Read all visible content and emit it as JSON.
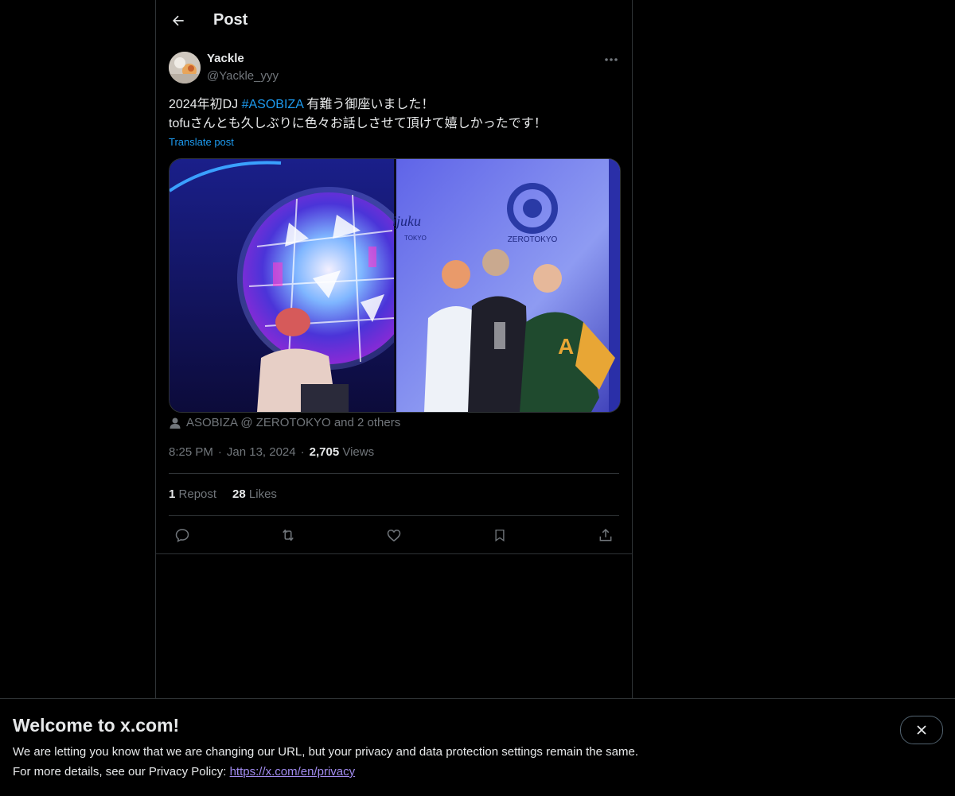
{
  "header": {
    "title": "Post",
    "back_icon": "arrow-left-icon"
  },
  "post": {
    "author": {
      "display_name": "Yackle",
      "handle": "@Yackle_yyy"
    },
    "text_line1_prefix": "2024年初DJ ",
    "hashtag": "#ASOBIZA",
    "text_line1_suffix": " 有難う御座いました！",
    "text_line2": "tofuさんとも久しぶりに色々お話しさせて頂けて嬉しかったです！",
    "translate_label": "Translate post",
    "media": {
      "left_image": "DJ performing in front of a large glowing disco-ball style screen",
      "right_image": "Three people posing in front of a ZEROTOKYO wall",
      "right_logo_text": "ZEROTOKYO",
      "right_sign_text": "ijuku",
      "right_sign_sub": "TOKYO"
    },
    "tagged": "ASOBIZA @ ZEROTOKYO and 2 others",
    "time": "8:25 PM",
    "date": "Jan 13, 2024",
    "views_count": "2,705",
    "views_label": "Views",
    "reposts_count": "1",
    "reposts_label": "Repost",
    "likes_count": "28",
    "likes_label": "Likes"
  },
  "actions": [
    "reply-icon",
    "repost-icon",
    "like-icon",
    "bookmark-icon",
    "share-icon"
  ],
  "banner": {
    "title": "Welcome to x.com!",
    "line1": "We are letting you know that we are changing our URL, but your privacy and data protection settings remain the same.",
    "line2_prefix": "For more details, see our Privacy Policy: ",
    "link": "https://x.com/en/privacy"
  },
  "colors": {
    "background": "#000000",
    "text": "#e7e9ea",
    "muted": "#71767b",
    "accent": "#1d9bf0",
    "border": "#2f3336"
  }
}
